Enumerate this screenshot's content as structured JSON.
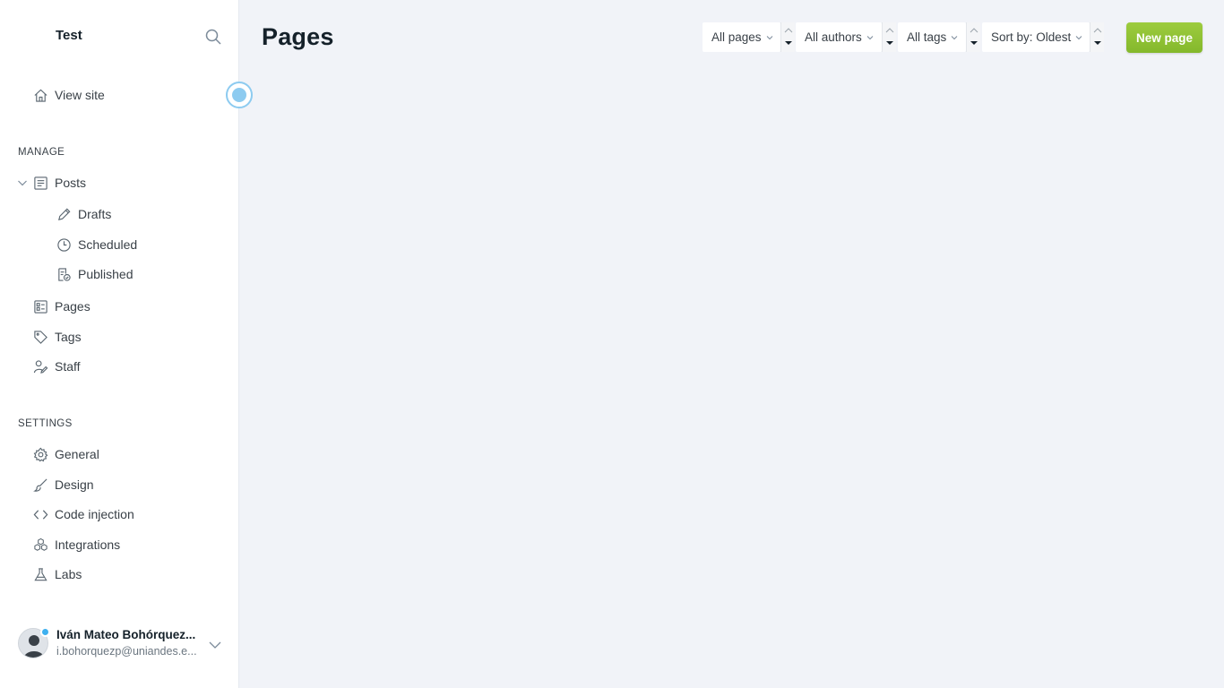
{
  "sidebar": {
    "site_title": "Test",
    "view_site": "View site",
    "manage_label": "MANAGE",
    "settings_label": "SETTINGS",
    "posts": "Posts",
    "drafts": "Drafts",
    "scheduled": "Scheduled",
    "published": "Published",
    "pages": "Pages",
    "tags": "Tags",
    "staff": "Staff",
    "general": "General",
    "design": "Design",
    "code_injection": "Code injection",
    "integrations": "Integrations",
    "labs": "Labs"
  },
  "user": {
    "name": "Iván Mateo Bohórquez...",
    "email": "i.bohorquezp@uniandes.e..."
  },
  "main": {
    "title": "Pages",
    "filters": {
      "type": "All pages",
      "author": "All authors",
      "tag": "All tags",
      "sort": "Sort by: Oldest"
    },
    "new_button": "New page"
  },
  "colors": {
    "accent_green": "#8bc34a",
    "status_blue": "#3eb0ef",
    "background": "#f1f3f8"
  }
}
